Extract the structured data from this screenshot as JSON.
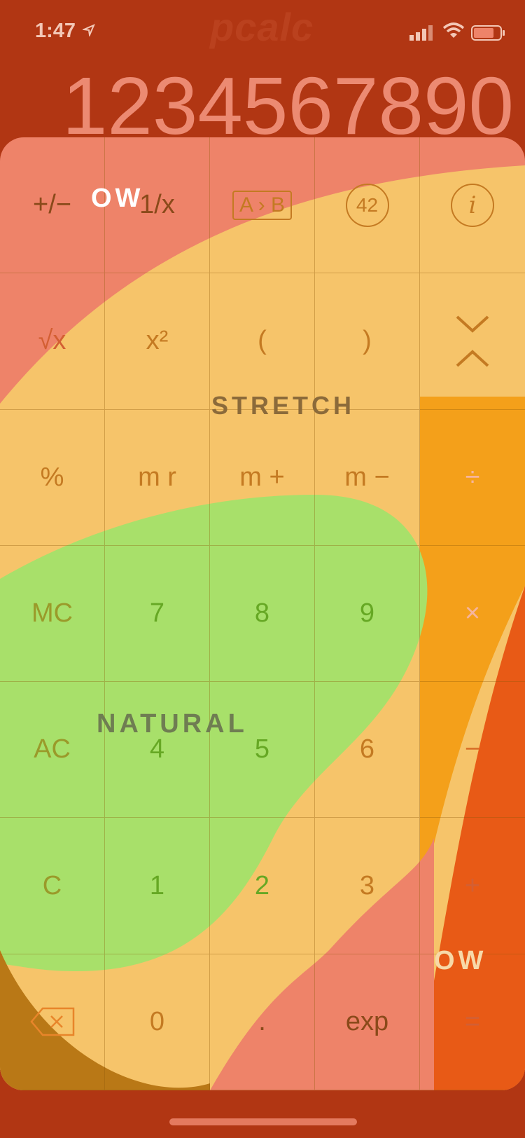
{
  "status": {
    "time": "1:47",
    "watermark": "pcalc"
  },
  "display": {
    "value": "1234567890"
  },
  "keys": [
    {
      "name": "plus-minus-key",
      "label": "+/−",
      "cls": "c-red"
    },
    {
      "name": "reciprocal-key",
      "label": "1/x",
      "cls": "c-red"
    },
    {
      "name": "a-to-b-key",
      "label": "A › B",
      "cls": "box"
    },
    {
      "name": "constant-42-key",
      "label": "42",
      "cls": "circle"
    },
    {
      "name": "info-key",
      "label": "i",
      "cls": "info"
    },
    {
      "name": "square-root-key",
      "label": "√x",
      "cls": "c-red"
    },
    {
      "name": "square-key",
      "label": "x²",
      "cls": "c-amber"
    },
    {
      "name": "open-paren-key",
      "label": "(",
      "cls": "c-amber"
    },
    {
      "name": "close-paren-key",
      "label": ")",
      "cls": "c-amber"
    },
    {
      "name": "chevron-toggle-key",
      "label": "",
      "cls": "chev"
    },
    {
      "name": "percent-key",
      "label": "%",
      "cls": "c-amber"
    },
    {
      "name": "memory-recall-key",
      "label": "m r",
      "cls": "c-amber"
    },
    {
      "name": "memory-add-key",
      "label": "m +",
      "cls": "c-amber"
    },
    {
      "name": "memory-subtract-key",
      "label": "m −",
      "cls": "c-amber"
    },
    {
      "name": "divide-key",
      "label": "÷",
      "cls": "c-white"
    },
    {
      "name": "memory-clear-key",
      "label": "MC",
      "cls": "c-olive"
    },
    {
      "name": "digit-7-key",
      "label": "7",
      "cls": "c-green"
    },
    {
      "name": "digit-8-key",
      "label": "8",
      "cls": "c-green"
    },
    {
      "name": "digit-9-key",
      "label": "9",
      "cls": "c-green"
    },
    {
      "name": "multiply-key",
      "label": "×",
      "cls": "c-white"
    },
    {
      "name": "all-clear-key",
      "label": "AC",
      "cls": "c-olive"
    },
    {
      "name": "digit-4-key",
      "label": "4",
      "cls": "c-green"
    },
    {
      "name": "digit-5-key",
      "label": "5",
      "cls": "c-green"
    },
    {
      "name": "digit-6-key",
      "label": "6",
      "cls": "c-amber"
    },
    {
      "name": "subtract-key",
      "label": "−",
      "cls": "c-orange"
    },
    {
      "name": "clear-key",
      "label": "C",
      "cls": "c-olive"
    },
    {
      "name": "digit-1-key",
      "label": "1",
      "cls": "c-green"
    },
    {
      "name": "digit-2-key",
      "label": "2",
      "cls": "c-green"
    },
    {
      "name": "digit-3-key",
      "label": "3",
      "cls": "c-amber"
    },
    {
      "name": "add-key",
      "label": "+",
      "cls": "c-red"
    },
    {
      "name": "backspace-key",
      "label": "",
      "cls": "back"
    },
    {
      "name": "digit-0-key",
      "label": "0",
      "cls": "c-amber"
    },
    {
      "name": "decimal-key",
      "label": ".",
      "cls": "c-dark"
    },
    {
      "name": "exponent-key",
      "label": "exp",
      "cls": "c-dark"
    },
    {
      "name": "equals-key",
      "label": "=",
      "cls": "c-red"
    }
  ],
  "zones": {
    "stretch": "STRETCH",
    "natural": "NATURAL",
    "ow_top": "OW",
    "ow_bottom": "OW"
  },
  "colors": {
    "background": "#b13613",
    "natural": "#a8e06a",
    "stretch": "#f6c46a",
    "ow": "#ee8369",
    "hot": "#e85a16"
  }
}
